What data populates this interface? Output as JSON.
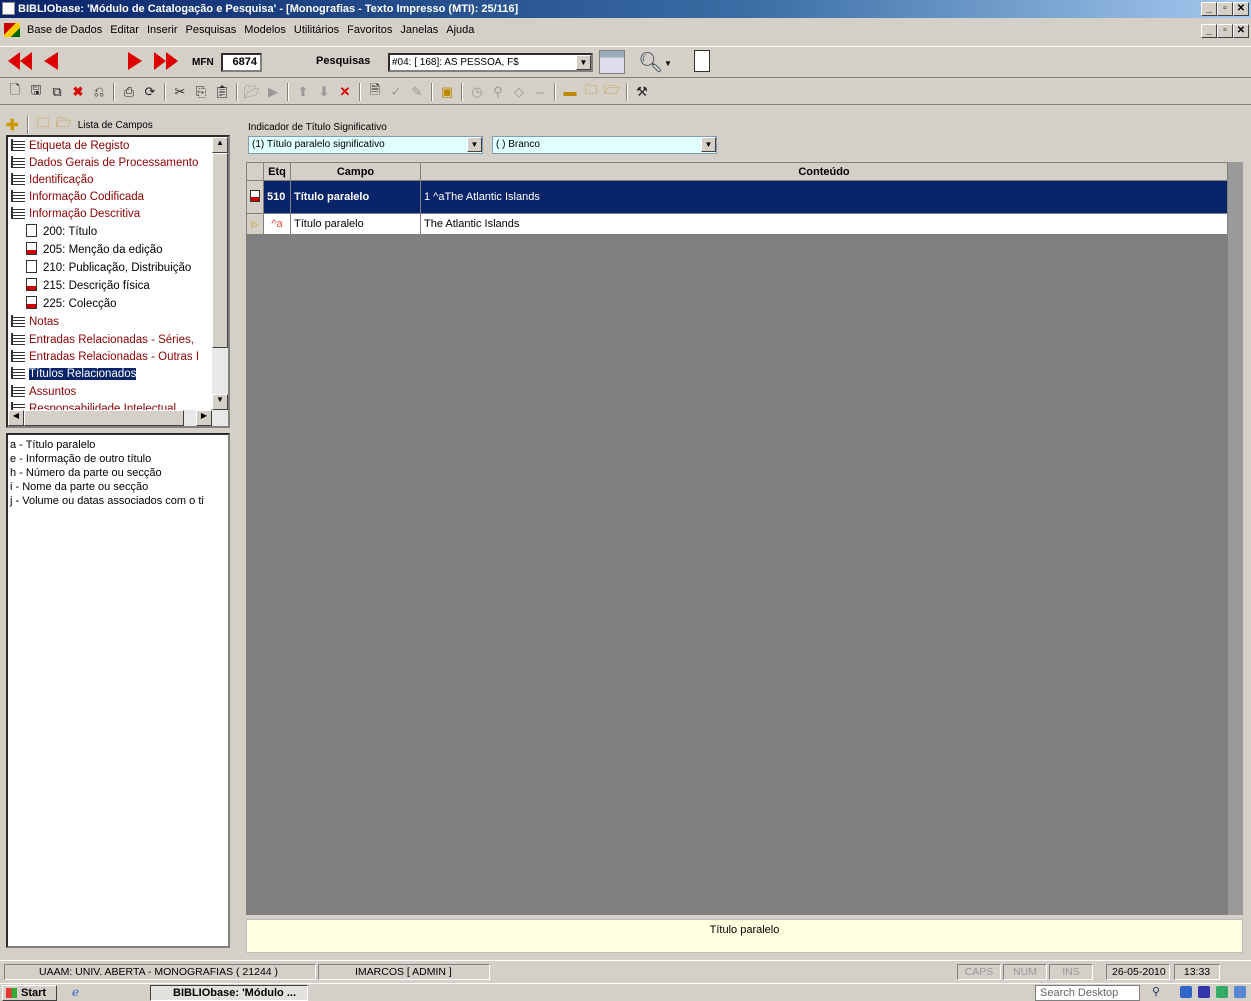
{
  "window": {
    "title": "BIBLIObase: 'Módulo de Catalogação e Pesquisa' - [Monografias - Texto Impresso  (MTI): 25/116]"
  },
  "menu": [
    "Base de Dados",
    "Editar",
    "Inserir",
    "Pesquisas",
    "Modelos",
    "Utilitários",
    "Favoritos",
    "Janelas",
    "Ajuda"
  ],
  "nav": {
    "mfn_label": "MFN",
    "mfn_value": "6874",
    "search_label": "Pesquisas",
    "search_value": "#04: [ 168]: AS PESSOA, F$"
  },
  "left": {
    "fields_list_label": "Lista de Campos",
    "tree": [
      {
        "label": "Etiqueta de Registo"
      },
      {
        "label": "Dados Gerais de Processamento"
      },
      {
        "label": "Identificação"
      },
      {
        "label": "Informação Codificada"
      },
      {
        "label": "Informação Descritiva"
      },
      {
        "label": "200: Título"
      },
      {
        "label": "205: Menção da edição"
      },
      {
        "label": "210: Publicação, Distribuição"
      },
      {
        "label": "215: Descrição física"
      },
      {
        "label": "225: Colecção"
      },
      {
        "label": "Notas"
      },
      {
        "label": "Entradas Relacionadas - Séries,"
      },
      {
        "label": "Entradas Relacionadas - Outras I"
      },
      {
        "label": "Títulos Relacionados"
      },
      {
        "label": "Assuntos"
      },
      {
        "label": "Responsabilidade Intelectual"
      }
    ],
    "subfields": [
      "a - Título paralelo",
      "e - Informação de outro título",
      "h - Número da parte ou secção",
      "i - Nome da parte ou secção",
      "j - Volume ou datas associados com o ti"
    ]
  },
  "indicator": {
    "label": "Indicador de Título Significativo",
    "ind1": "(1) Título paralelo significativo",
    "ind2": "( ) Branco"
  },
  "grid": {
    "headers": {
      "etq": "Etq",
      "campo": "Campo",
      "conteudo": "Conteúdo"
    },
    "rows": [
      {
        "etq": "510",
        "campo": "Título paralelo",
        "conteudo": "1 ^aThe Atlantic Islands"
      },
      {
        "etq": "^a",
        "campo": "Título paralelo",
        "conteudo": "The Atlantic Islands"
      }
    ]
  },
  "hint": "Título paralelo",
  "status": {
    "library": "UAAM: UNIV. ABERTA - MONOGRAFIAS  ( 21244 )",
    "user": "IMARCOS  [ ADMIN ]",
    "caps": "CAPS",
    "num": "NUM",
    "ins": "INS",
    "date": "26-05-2010",
    "time": "13:33"
  },
  "taskbar": {
    "start": "Start",
    "task": "BIBLIObase: 'Módulo ...",
    "search": "Search Desktop"
  }
}
